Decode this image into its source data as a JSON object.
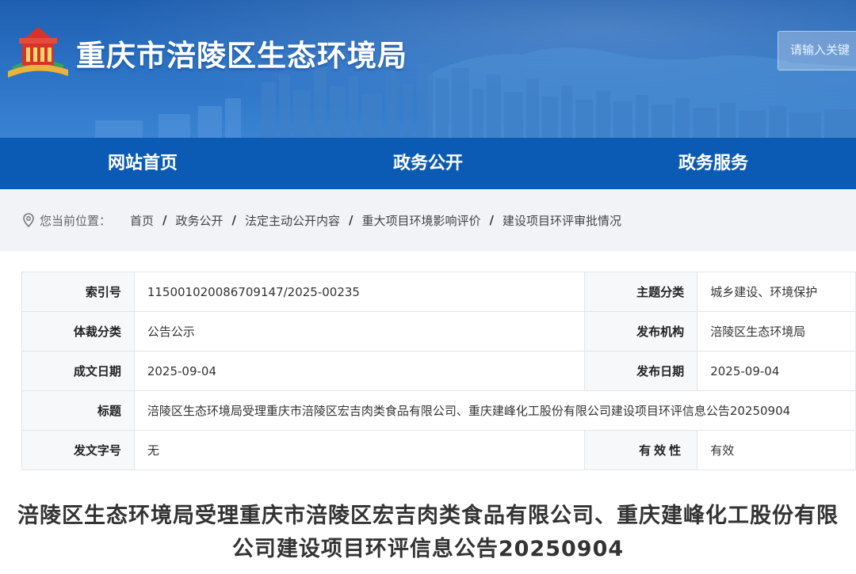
{
  "header": {
    "site_title": "重庆市涪陵区生态环境局",
    "search_placeholder": "请输入关键"
  },
  "nav": {
    "items": [
      "网站首页",
      "政务公开",
      "政务服务"
    ]
  },
  "breadcrumb": {
    "prefix": "您当前位置：",
    "items": [
      "首页",
      "政务公开",
      "法定主动公开内容",
      "重大项目环境影响评价",
      "建设项目环评审批情况"
    ]
  },
  "meta": {
    "index_no_label": "索引号",
    "index_no": "115001020086709147/2025-00235",
    "topic_label": "主题分类",
    "topic": "城乡建设、环境保护",
    "genre_label": "体裁分类",
    "genre": "公告公示",
    "publisher_label": "发布机构",
    "publisher": "涪陵区生态环境局",
    "written_date_label": "成文日期",
    "written_date": "2025-09-04",
    "publish_date_label": "发布日期",
    "publish_date": "2025-09-04",
    "title_label": "标题",
    "title": "涪陵区生态环境局受理重庆市涪陵区宏吉肉类食品有限公司、重庆建峰化工股份有限公司建设项目环评信息公告20250904",
    "doc_no_label": "发文字号",
    "doc_no": "无",
    "validity_label": "有效性",
    "validity": "有效"
  },
  "article": {
    "title": "涪陵区生态环境局受理重庆市涪陵区宏吉肉类食品有限公司、重庆建峰化工股份有限公司建设项目环评信息公告20250904"
  }
}
